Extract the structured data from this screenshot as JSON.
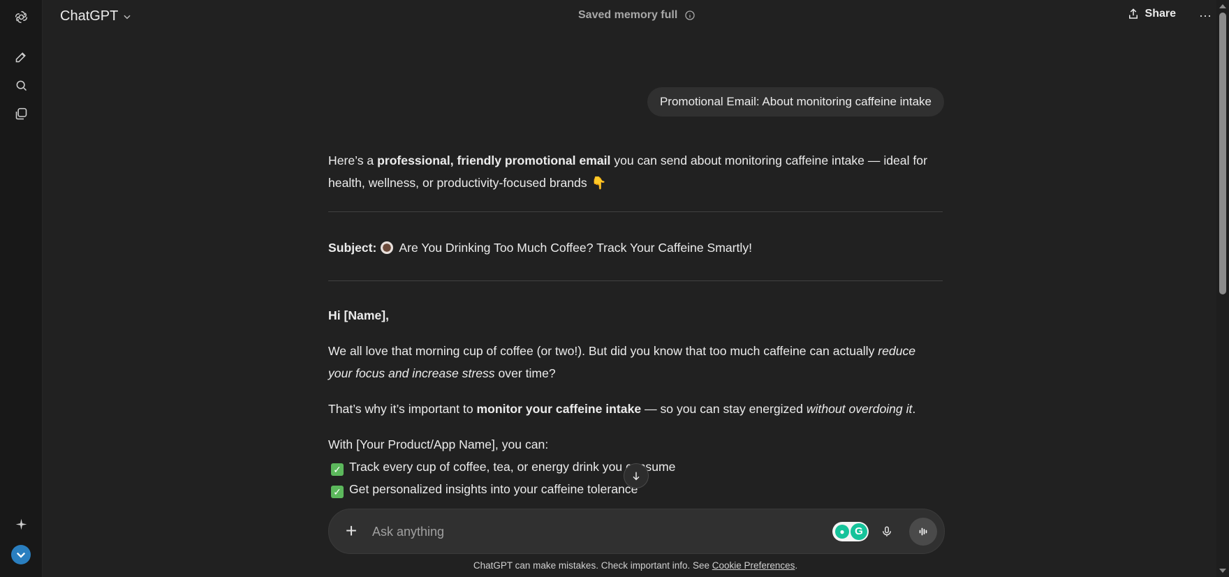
{
  "header": {
    "model_name": "ChatGPT",
    "memory_status": "Saved memory full",
    "share_label": "Share",
    "more_label": "···"
  },
  "sidebar": {
    "items": [
      {
        "name": "logo",
        "icon": "openai-logo-icon"
      },
      {
        "name": "new-chat",
        "icon": "edit-icon"
      },
      {
        "name": "search",
        "icon": "search-icon"
      },
      {
        "name": "library",
        "icon": "images-icon"
      },
      {
        "name": "explore",
        "icon": "sparkle-icon"
      },
      {
        "name": "profile",
        "icon": "avatar-icon"
      }
    ]
  },
  "conversation": {
    "user_message": "Promotional Email: About monitoring caffeine intake",
    "intro_1": "Here’s a ",
    "intro_bold": "professional, friendly promotional email",
    "intro_2": " you can send about monitoring caffeine intake — ideal for health, wellness, or productivity-focused brands",
    "intro_emoji": "👇",
    "subject_label": "Subject:",
    "subject_text": "Are You Drinking Too Much Coffee? Track Your Caffeine Smartly!",
    "greeting": "Hi [Name],",
    "p1_a": "We all love that morning cup of coffee (or two!). But did you know that too much caffeine can actually ",
    "p1_italic": "reduce your focus and increase stress",
    "p1_b": " over time?",
    "p2_a": "That’s why it’s important to ",
    "p2_bold": "monitor your caffeine intake",
    "p2_b": " — so you can stay energized ",
    "p2_italic": "without overdoing it",
    "p2_c": ".",
    "p3": "With [Your Product/App Name], you can:",
    "bullets": [
      "Track every cup of coffee, tea, or energy drink you consume",
      "Get personalized insights into your caffeine tolerance"
    ]
  },
  "composer": {
    "placeholder": "Ask anything"
  },
  "footer": {
    "text": "ChatGPT can make mistakes. Check important info. See ",
    "link": "Cookie Preferences",
    "end": "."
  },
  "colors": {
    "background": "#212121",
    "sidebar": "#181818",
    "bubble": "#303030",
    "check_green": "#5cb85c",
    "grammarly_green": "#15c39a"
  }
}
